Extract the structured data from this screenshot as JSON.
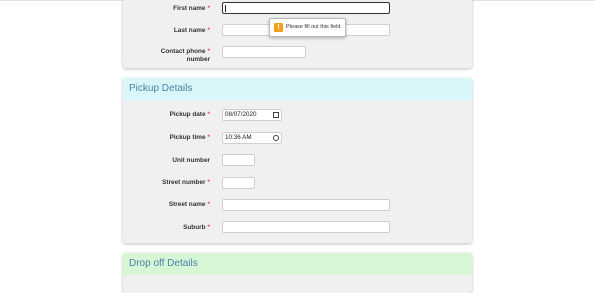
{
  "contact": {
    "first_name_label": "First name",
    "last_name_label": "Last name",
    "phone_label_1": "Contact phone",
    "phone_label_2": "number",
    "required_mark": "*",
    "tooltip_icon": "!",
    "tooltip_text": "Please fill out this field."
  },
  "pickup": {
    "title": "Pickup Details",
    "header_color": "#d9f7fb",
    "date_label": "Pickup date",
    "date_value": "08/07/2020",
    "time_label": "Pickup time",
    "time_value": "10:36 AM",
    "unit_label": "Unit number",
    "street_number_label": "Street number",
    "street_name_label": "Street name",
    "suburb_label": "Suburb"
  },
  "dropoff": {
    "title": "Drop off Details",
    "header_color": "#d6f6d6"
  }
}
